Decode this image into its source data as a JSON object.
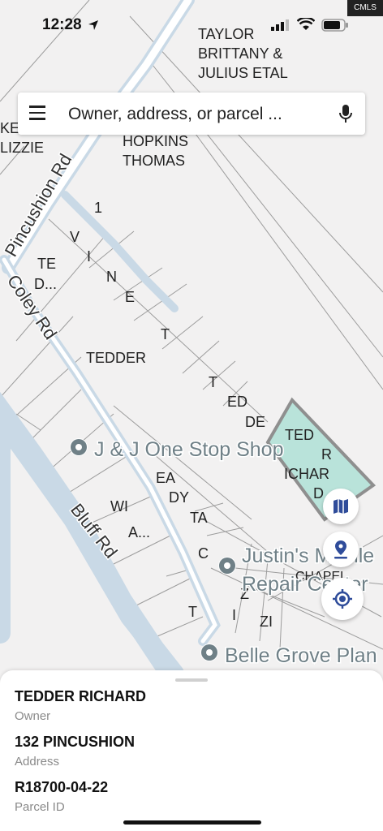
{
  "status_bar": {
    "time": "12:28",
    "watermark": "CMLS"
  },
  "search": {
    "placeholder": "Owner, address, or parcel ..."
  },
  "map": {
    "roads": {
      "pincushion": "Pincushion Rd",
      "coley": "Coley Rd",
      "bluff": "Bluff Rd"
    },
    "owner_labels": {
      "taylor": "TAYLOR BRITTANY & JULIUS ETAL",
      "taylor_l1": "TAYLOR",
      "taylor_l2": "BRITTANY &",
      "taylor_l3": "JULIUS ETAL",
      "hopkins_l1": "HOPKINS",
      "hopkins_l2": "THOMAS",
      "ke": "KE",
      "lizzie": "LIZZIE",
      "te": "TE",
      "d_dots": "D...",
      "tedder": "TEDDER",
      "one": "1",
      "vinett": [
        "V",
        "I",
        "N",
        "E",
        "T",
        "T"
      ],
      "ted_diag": [
        "ED",
        "DE"
      ],
      "selected_l1": "TED",
      "selected_l2": "R",
      "selected_l3": "ICHAR",
      "selected_l4": "D",
      "ea": "EA",
      "dy": "DY",
      "ta": "TA",
      "wi": "WI",
      "a_dots": "A...",
      "c": "C",
      "t": "T",
      "i": "I",
      "z": "Z",
      "zi": "ZI",
      "chapel": "CHAPEL"
    },
    "pois": {
      "jj": "J & J One Stop Shop",
      "justins_l1": "Justin's Mobile",
      "justins_l2": "Repair Center",
      "belle": "Belle Grove Plan"
    },
    "colors": {
      "road": "#c9d9e6",
      "selected_fill": "#b9e3da",
      "selected_stroke": "#8f8f8f",
      "poi": "#6f8087"
    }
  },
  "fabs": {
    "layers": "map-icon",
    "pin": "pin-icon",
    "locate": "my-location-icon"
  },
  "parcel": {
    "owner_value": "TEDDER RICHARD",
    "owner_label": "Owner",
    "address_value": "132 PINCUSHION",
    "address_label": "Address",
    "parcel_value": "R18700-04-22",
    "parcel_label": "Parcel ID"
  }
}
